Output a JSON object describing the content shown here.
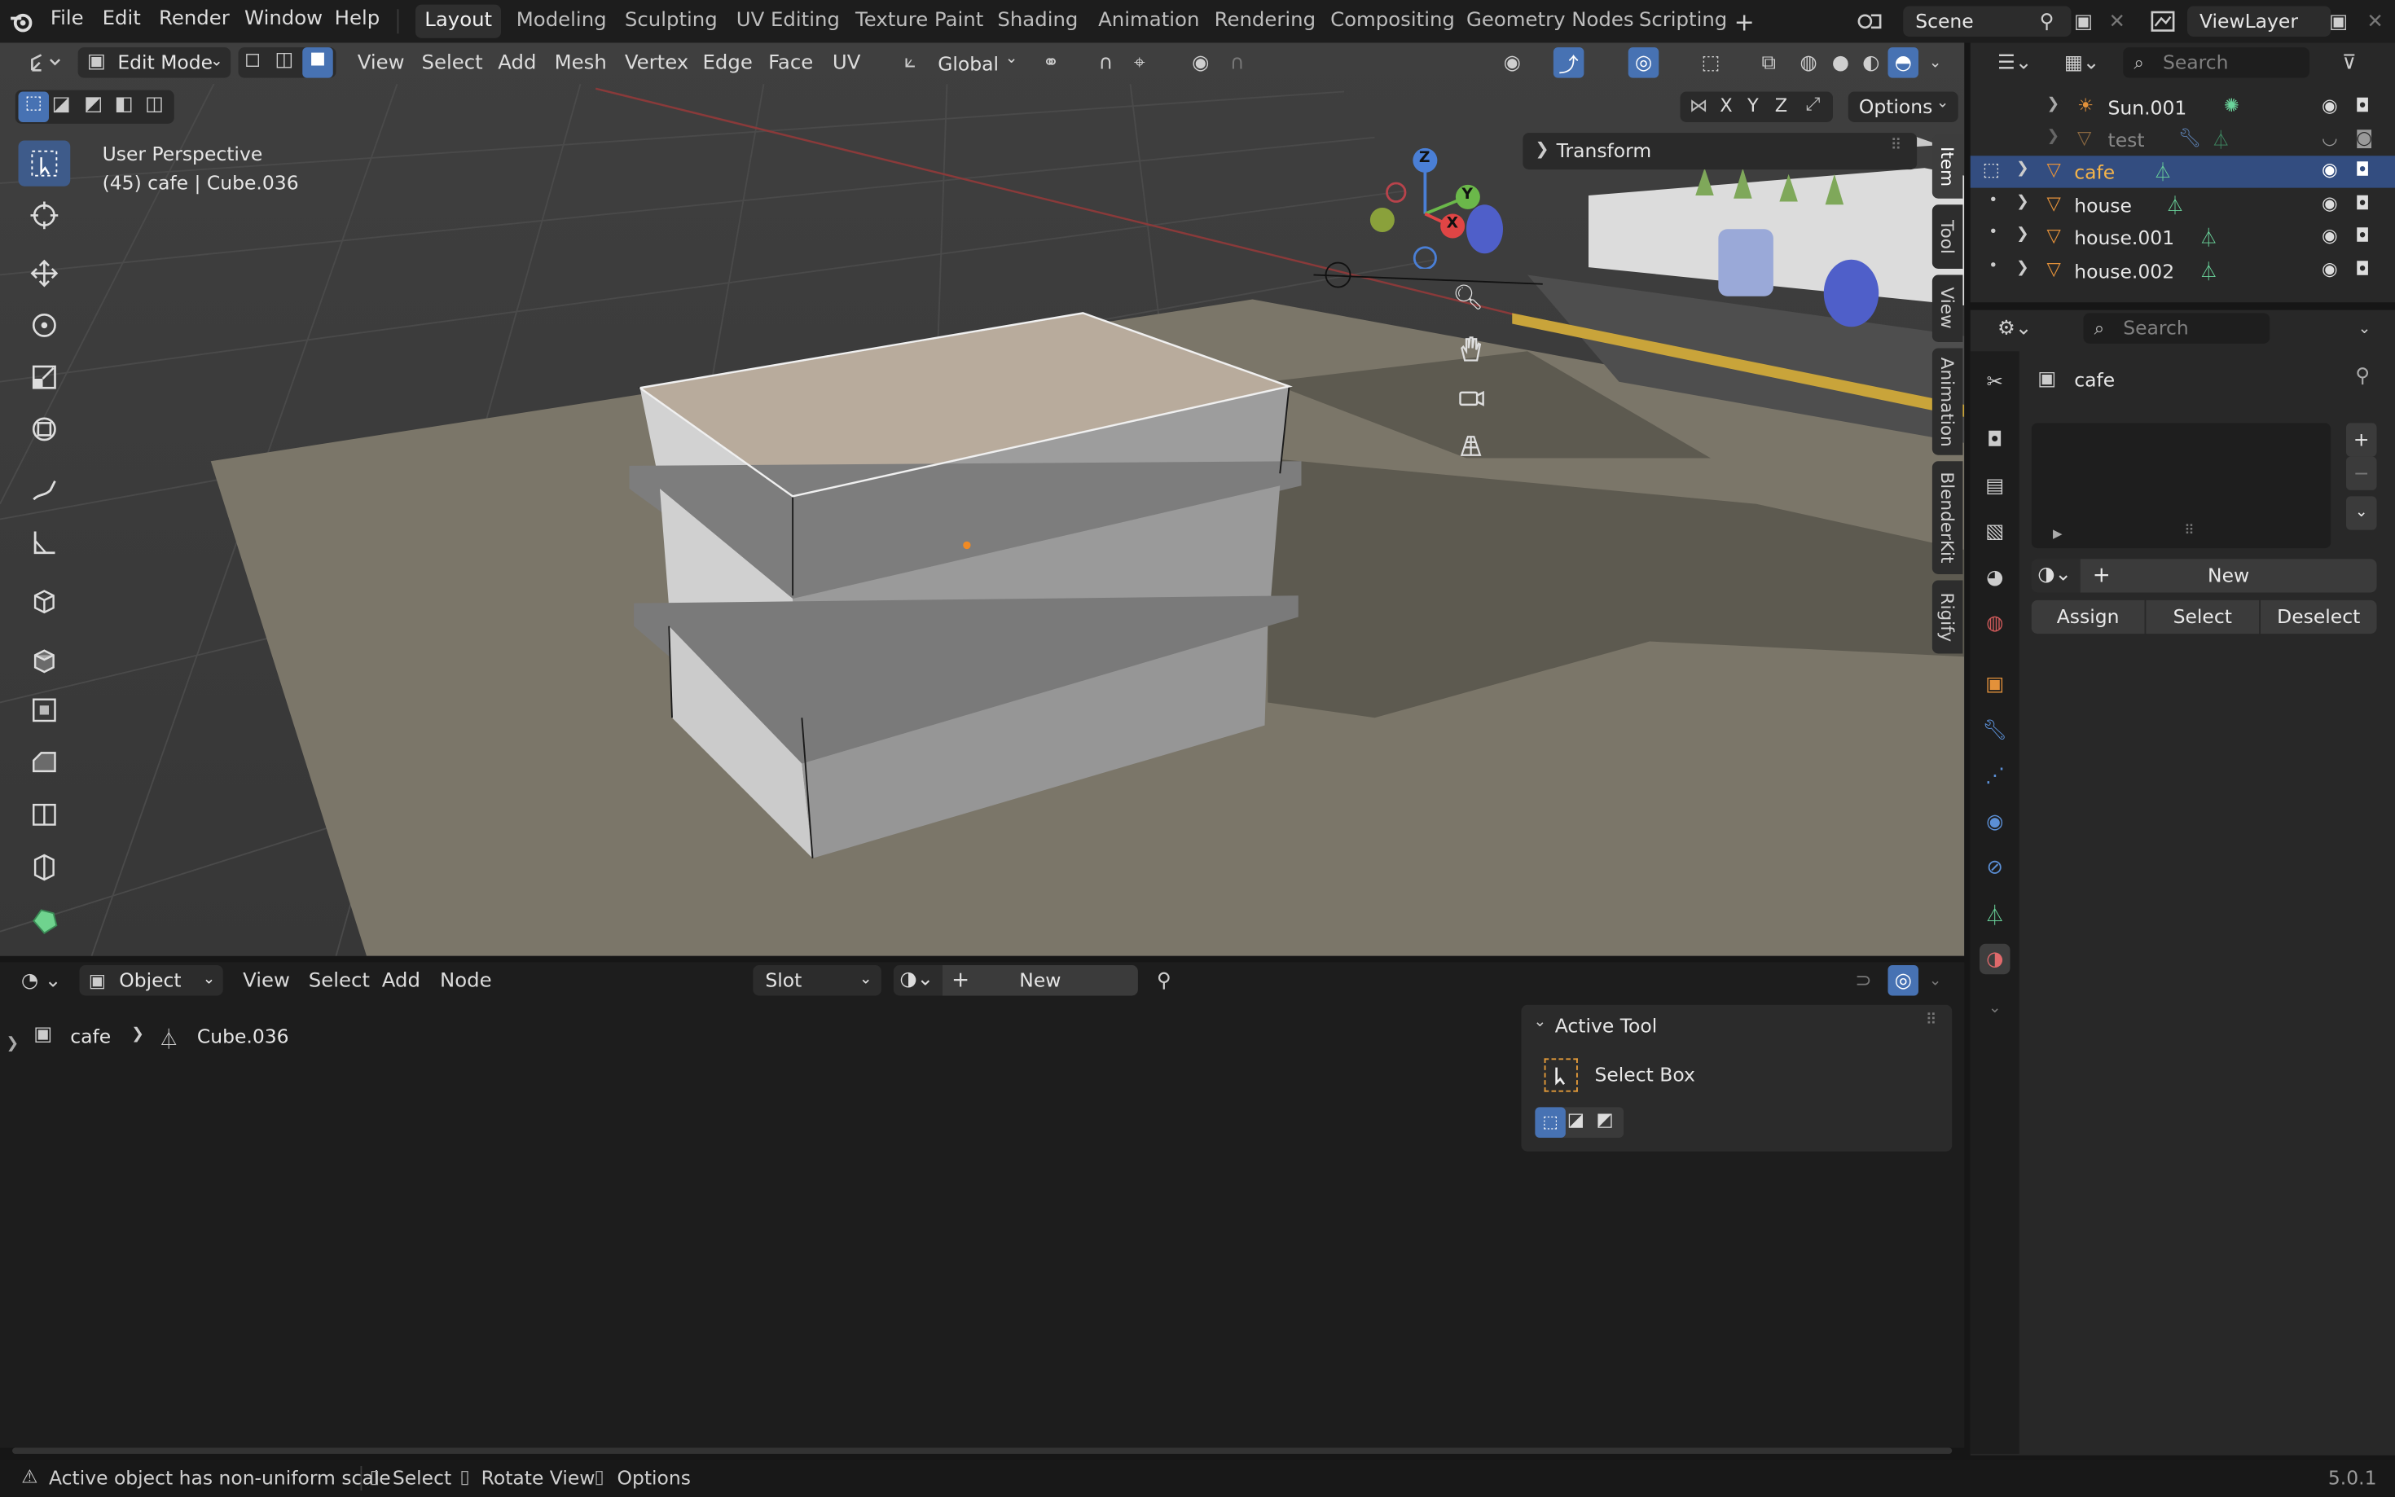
{
  "menu": {
    "file": "File",
    "edit": "Edit",
    "render": "Render",
    "window": "Window",
    "help": "Help"
  },
  "workspaces": [
    "Layout",
    "Modeling",
    "Sculpting",
    "UV Editing",
    "Texture Paint",
    "Shading",
    "Animation",
    "Rendering",
    "Compositing",
    "Geometry Nodes",
    "Scripting"
  ],
  "scene": {
    "name": "Scene"
  },
  "view_layer": {
    "name": "ViewLayer"
  },
  "viewport": {
    "mode": "Edit Mode",
    "menus": [
      "View",
      "Select",
      "Add",
      "Mesh",
      "Vertex",
      "Edge",
      "Face",
      "UV"
    ],
    "transform_orientation": "Global",
    "perspective_label": "User Perspective",
    "object_info": "(45) cafe | Cube.036",
    "options_label": "Options",
    "transform_panel": "Transform",
    "axis_x": "X",
    "axis_y": "Y",
    "axis_z": "Z",
    "gizmo_x": "X",
    "gizmo_y": "Y",
    "gizmo_z": "Z",
    "side_tabs": [
      "Item",
      "Tool",
      "View",
      "Animation",
      "BlenderKit",
      "Rigify"
    ]
  },
  "node_editor": {
    "object_mode": "Object",
    "menus": [
      "View",
      "Select",
      "Add",
      "Node"
    ],
    "slot": "Slot",
    "new_label": "New",
    "breadcrumb_object": "cafe",
    "breadcrumb_mesh": "Cube.036",
    "active_tool_title": "Active Tool",
    "active_tool_name": "Select Box"
  },
  "outliner": {
    "search_placeholder": "Search",
    "rows": [
      {
        "name": "Sun.001"
      },
      {
        "name": "test"
      },
      {
        "name": "cafe"
      },
      {
        "name": "house"
      },
      {
        "name": "house.001"
      },
      {
        "name": "house.002"
      }
    ]
  },
  "properties": {
    "search_placeholder": "Search",
    "object_name": "cafe",
    "new_label": "New",
    "assign_label": "Assign",
    "select_label": "Select",
    "deselect_label": "Deselect"
  },
  "status": {
    "warning": "Active object has non-uniform scale",
    "select": "Select",
    "rotate": "Rotate View",
    "options": "Options",
    "version": "5.0.1"
  },
  "colors": {
    "accent": "#4772b3",
    "selection": "#334d80",
    "mesh_icon": "#e3913a",
    "data_icon": "#5dd39a"
  }
}
